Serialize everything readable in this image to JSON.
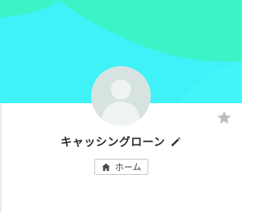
{
  "profile": {
    "name": "キャッシングローン",
    "home_label": "ホーム"
  },
  "icons": {
    "avatar": "default-user-silhouette",
    "favorite": "star-icon",
    "edit": "pencil-icon",
    "home": "house-icon"
  },
  "colors": {
    "cover_primary": "#3ff2f8",
    "cover_accent": "#3cf2c7",
    "avatar_bg": "#d6e3e0",
    "star": "#bdbdbd"
  }
}
